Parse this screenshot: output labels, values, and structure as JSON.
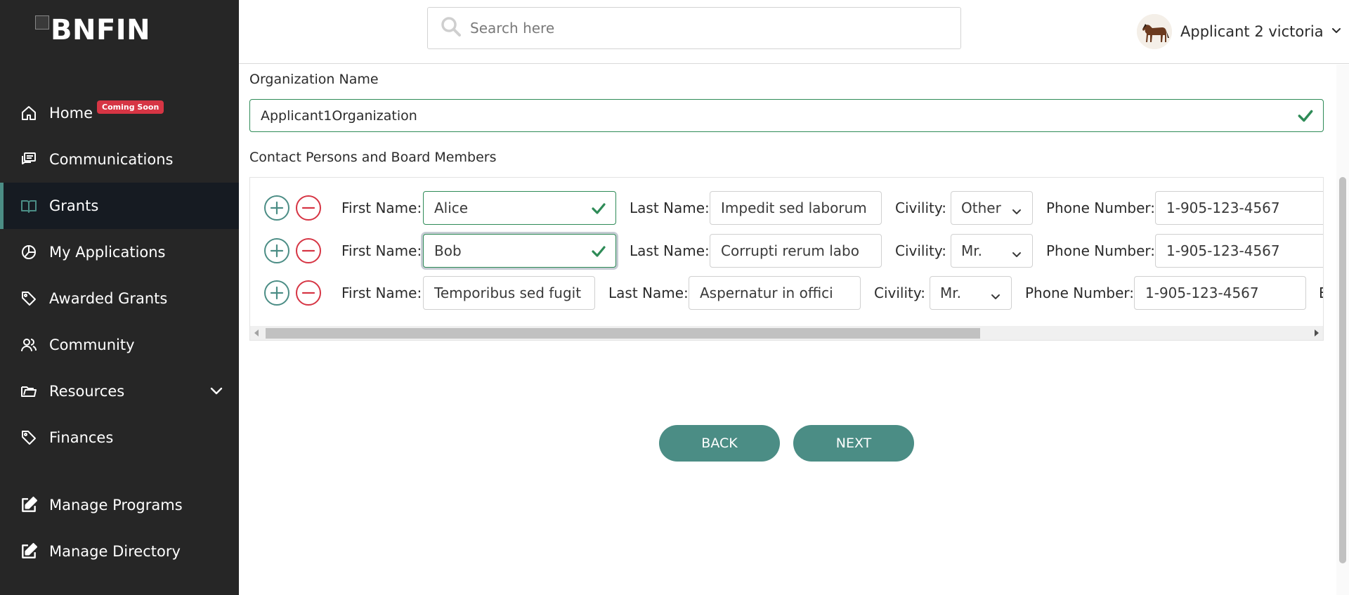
{
  "sidebar": {
    "logo_text": "BNFIN",
    "items": [
      {
        "label": "Home",
        "badge": "Coming Soon",
        "icon": "home-icon"
      },
      {
        "label": "Communications",
        "icon": "chat-icon"
      },
      {
        "label": "Grants",
        "icon": "book-icon",
        "active": true
      },
      {
        "label": "My Applications",
        "icon": "pie-chart-icon"
      },
      {
        "label": "Awarded Grants",
        "icon": "tag-icon"
      },
      {
        "label": "Community",
        "icon": "users-icon"
      },
      {
        "label": "Resources",
        "icon": "folder-icon",
        "expandable": true
      },
      {
        "label": "Finances",
        "icon": "tag-icon"
      },
      {
        "label": "Manage Programs",
        "icon": "edit-icon"
      },
      {
        "label": "Manage Directory",
        "icon": "edit-icon"
      }
    ]
  },
  "header": {
    "search_placeholder": "Search here",
    "user_name": "Applicant 2 victoria"
  },
  "form": {
    "org_label": "Organization Name",
    "org_value": "Applicant1Organization",
    "contacts_label": "Contact Persons and Board Members",
    "labels": {
      "first_name": "First Name:",
      "last_name": "Last Name:",
      "civility": "Civility:",
      "phone": "Phone Number:",
      "next_col_partial": "E"
    },
    "rows": [
      {
        "first_name": "Alice",
        "last_name": "Impedit sed laborum",
        "civility": "Other",
        "phone": "1-905-123-4567"
      },
      {
        "first_name": "Bob",
        "last_name": "Corrupti rerum labo",
        "civility": "Mr.",
        "phone": "1-905-123-4567"
      },
      {
        "first_name": "Temporibus sed fugit",
        "last_name": "Aspernatur in offici",
        "civility": "Mr.",
        "phone": "1-905-123-4567"
      }
    ]
  },
  "buttons": {
    "back": "BACK",
    "next": "NEXT"
  },
  "colors": {
    "sidebar_bg": "#262626",
    "accent": "#4b8d85",
    "valid": "#2e8b57",
    "remove": "#d63544"
  }
}
